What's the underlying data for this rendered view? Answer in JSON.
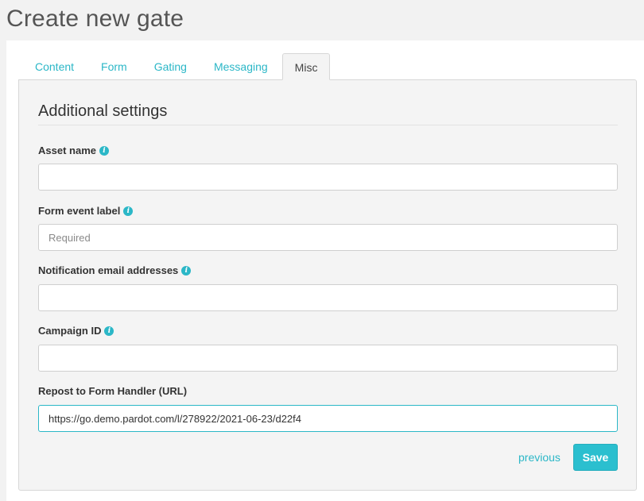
{
  "page": {
    "title": "Create new gate"
  },
  "tabs": [
    {
      "label": "Content",
      "active": false
    },
    {
      "label": "Form",
      "active": false
    },
    {
      "label": "Gating",
      "active": false
    },
    {
      "label": "Messaging",
      "active": false
    },
    {
      "label": "Misc",
      "active": true
    }
  ],
  "section": {
    "title": "Additional settings"
  },
  "fields": {
    "asset_name": {
      "label": "Asset name",
      "value": "",
      "placeholder": "",
      "icon": "info-icon"
    },
    "form_event_label": {
      "label": "Form event label",
      "value": "",
      "placeholder": "Required",
      "icon": "info-icon"
    },
    "notification_emails": {
      "label": "Notification email addresses",
      "value": "",
      "placeholder": "",
      "icon": "info-icon"
    },
    "campaign_id": {
      "label": "Campaign ID",
      "value": "",
      "placeholder": "",
      "icon": "info-icon"
    },
    "repost_url": {
      "label": "Repost to Form Handler (URL)",
      "value": "https://go.demo.pardot.com/l/278922/2021-06-23/d22f4",
      "placeholder": ""
    }
  },
  "actions": {
    "previous_label": "previous",
    "save_label": "Save"
  },
  "colors": {
    "accent": "#2bb7c7",
    "panel_bg": "#f4f4f4",
    "page_bg": "#f2f2f2"
  }
}
